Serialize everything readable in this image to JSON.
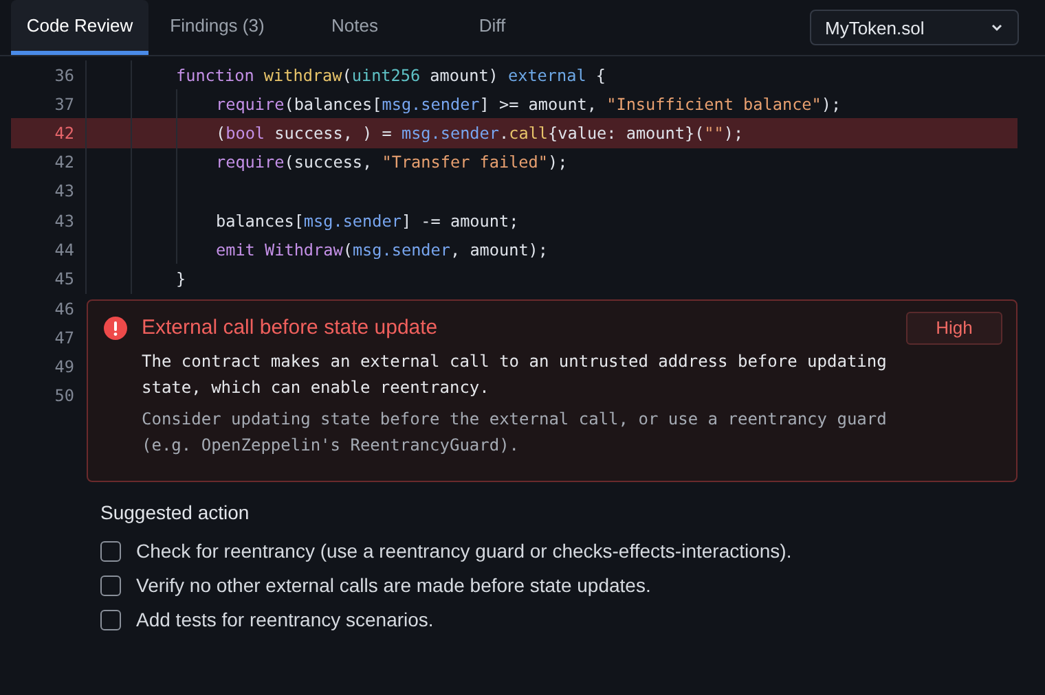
{
  "tabs": [
    {
      "label": "Code Review",
      "selected": true
    },
    {
      "label": "Findings (3)",
      "selected": false
    },
    {
      "label": "Notes",
      "selected": false
    },
    {
      "label": "Diff",
      "selected": false
    }
  ],
  "file_select": {
    "value": "MyToken.sol"
  },
  "code": {
    "lines": [
      {
        "number": "36",
        "highlighted": false,
        "tokens": [
          {
            "kind": "keyword",
            "text": "function"
          },
          {
            "kind": "function",
            "text": "withdraw",
            "space_before": true
          },
          {
            "kind": "plain",
            "text": "("
          },
          {
            "kind": "type",
            "text": "uint256"
          },
          {
            "kind": "plain",
            "text": " amount) "
          },
          {
            "kind": "modifier",
            "text": "external"
          },
          {
            "kind": "plain",
            "text": " {"
          }
        ],
        "children": [
          {
            "number": "37",
            "highlighted": false,
            "tokens": [
              {
                "kind": "builtin",
                "text": "require"
              },
              {
                "kind": "plain",
                "text": "(balances["
              },
              {
                "kind": "variable",
                "text": "msg.sender"
              },
              {
                "kind": "plain",
                "text": "] >= amount, "
              },
              {
                "kind": "string",
                "text": "\"Insufficient balance\""
              },
              {
                "kind": "plain",
                "text": ");"
              }
            ]
          },
          {
            "number": "42",
            "highlighted": true,
            "tokens": [
              {
                "kind": "plain",
                "text": "("
              },
              {
                "kind": "keyword",
                "text": "bool"
              },
              {
                "kind": "plain",
                "text": " success, ) = "
              },
              {
                "kind": "variable",
                "text": "msg.sender"
              },
              {
                "kind": "plain",
                "text": "."
              },
              {
                "kind": "function",
                "text": "call"
              },
              {
                "kind": "plain",
                "text": "{value: amount}("
              },
              {
                "kind": "string",
                "text": "\"\""
              },
              {
                "kind": "plain",
                "text": ");"
              }
            ]
          },
          {
            "number": "42",
            "highlighted": false,
            "tokens": [
              {
                "kind": "builtin",
                "text": "require"
              },
              {
                "kind": "plain",
                "text": "(success, "
              },
              {
                "kind": "string",
                "text": "\"Transfer failed\""
              },
              {
                "kind": "plain",
                "text": ");"
              }
            ]
          },
          {
            "number": "43",
            "highlighted": false
          },
          {
            "number": "43",
            "highlighted": false,
            "tokens": [
              {
                "kind": "plain",
                "text": "balances["
              },
              {
                "kind": "variable",
                "text": "msg.sender"
              },
              {
                "kind": "plain",
                "text": "] -= amount;"
              }
            ]
          },
          {
            "number": "44",
            "highlighted": false,
            "tokens": [
              {
                "kind": "builtin",
                "text": "emit"
              },
              {
                "kind": "event",
                "text": "Withdraw",
                "space_before": true
              },
              {
                "kind": "plain",
                "text": "("
              },
              {
                "kind": "variable",
                "text": "msg.sender"
              },
              {
                "kind": "plain",
                "text": ", amount);"
              }
            ]
          }
        ]
      },
      {
        "number": "45",
        "highlighted": false,
        "tokens": [
          {
            "kind": "plain",
            "text": "}"
          }
        ]
      }
    ],
    "trailing_line_numbers": [
      "46",
      "47",
      "49",
      "50"
    ]
  },
  "finding": {
    "title": "External call before state update",
    "severity": "High",
    "description": "The contract makes an external call to an untrusted address before updating state, which can enable reentrancy.",
    "advice": "Consider updating state before the external call, or use a reentrancy guard (e.g. OpenZeppelin's ReentrancyGuard)."
  },
  "suggested_action": {
    "title": "Suggested action",
    "items": [
      {
        "label": "Check for reentrancy (use a reentrancy guard or checks-effects-interactions).",
        "checked": false
      },
      {
        "label": "Verify no other external calls are made before state updates.",
        "checked": false
      },
      {
        "label": "Add tests for reentrancy scenarios.",
        "checked": false
      }
    ]
  }
}
